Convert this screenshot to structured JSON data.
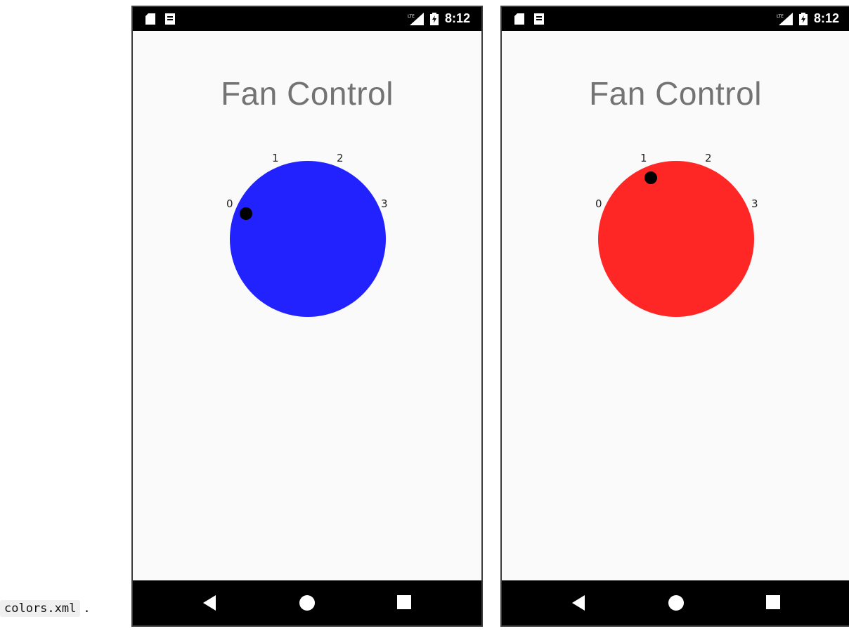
{
  "caption": {
    "code": "colors.xml",
    "trailing": "."
  },
  "screens": [
    {
      "status_bar": {
        "left_icons": [
          "sd-card-icon",
          "notification-icon"
        ],
        "right_icons": [
          "lte-signal-icon",
          "battery-icon"
        ],
        "time": "8:12"
      },
      "title": "Fan Control",
      "dial": {
        "color": "#2222ff",
        "labels": [
          "0",
          "1",
          "2",
          "3"
        ],
        "selected_setting": "0"
      },
      "nav_bar": [
        "back-icon",
        "home-icon",
        "recents-icon"
      ]
    },
    {
      "status_bar": {
        "left_icons": [
          "sd-card-icon",
          "notification-icon"
        ],
        "right_icons": [
          "lte-signal-icon",
          "battery-icon"
        ],
        "time": "8:12"
      },
      "title": "Fan Control",
      "dial": {
        "color": "#ff2626",
        "labels": [
          "0",
          "1",
          "2",
          "3"
        ],
        "selected_setting": "1"
      },
      "nav_bar": [
        "back-icon",
        "home-icon",
        "recents-icon"
      ]
    }
  ]
}
